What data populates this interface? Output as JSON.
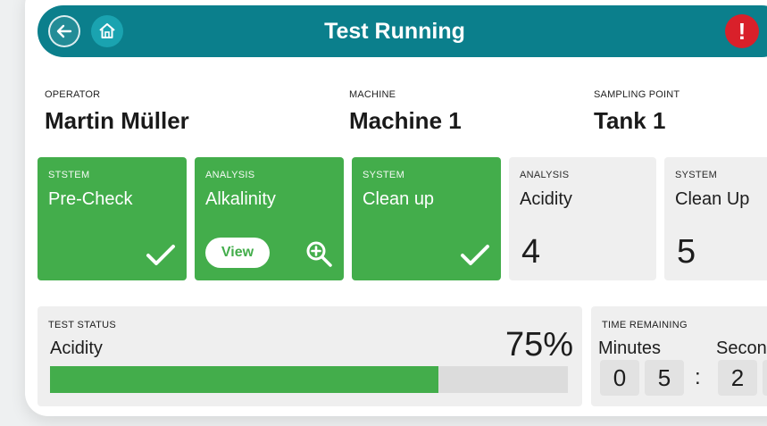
{
  "header": {
    "title": "Test Running",
    "back_icon": "arrow-left-icon",
    "home_icon": "home-icon",
    "alert_symbol": "!",
    "alert_color": "#d9202a",
    "bar_color": "#0b7f8c"
  },
  "info": {
    "operator_label": "OPERATOR",
    "operator_value": "Martin Müller",
    "machine_label": "MACHINE",
    "machine_value": "Machine 1",
    "sampling_label": "SAMPLING POINT",
    "sampling_value": "Tank 1"
  },
  "steps": [
    {
      "label": "STSTEM",
      "name": "Pre-Check",
      "state": "done"
    },
    {
      "label": "ANALYSIS",
      "name": "Alkalinity",
      "state": "done",
      "button": "View"
    },
    {
      "label": "SYSTEM",
      "name": "Clean up",
      "state": "done"
    },
    {
      "label": "ANALYSIS",
      "name": "Acidity",
      "state": "pending",
      "number": "4"
    },
    {
      "label": "SYSTEM",
      "name": "Clean Up",
      "state": "pending",
      "number": "5"
    }
  ],
  "status": {
    "label": "TEST STATUS",
    "name": "Acidity",
    "percent_text": "75%",
    "progress": 0.75
  },
  "time": {
    "label": "TIME REMAINING",
    "minutes_label": "Minutes",
    "seconds_label": "Secon",
    "minutes_digits": [
      "0",
      "5"
    ],
    "separator": ":",
    "seconds_digits": [
      "2"
    ]
  },
  "colors": {
    "done_green": "#43ad4b",
    "pending_gray": "#efefef"
  }
}
